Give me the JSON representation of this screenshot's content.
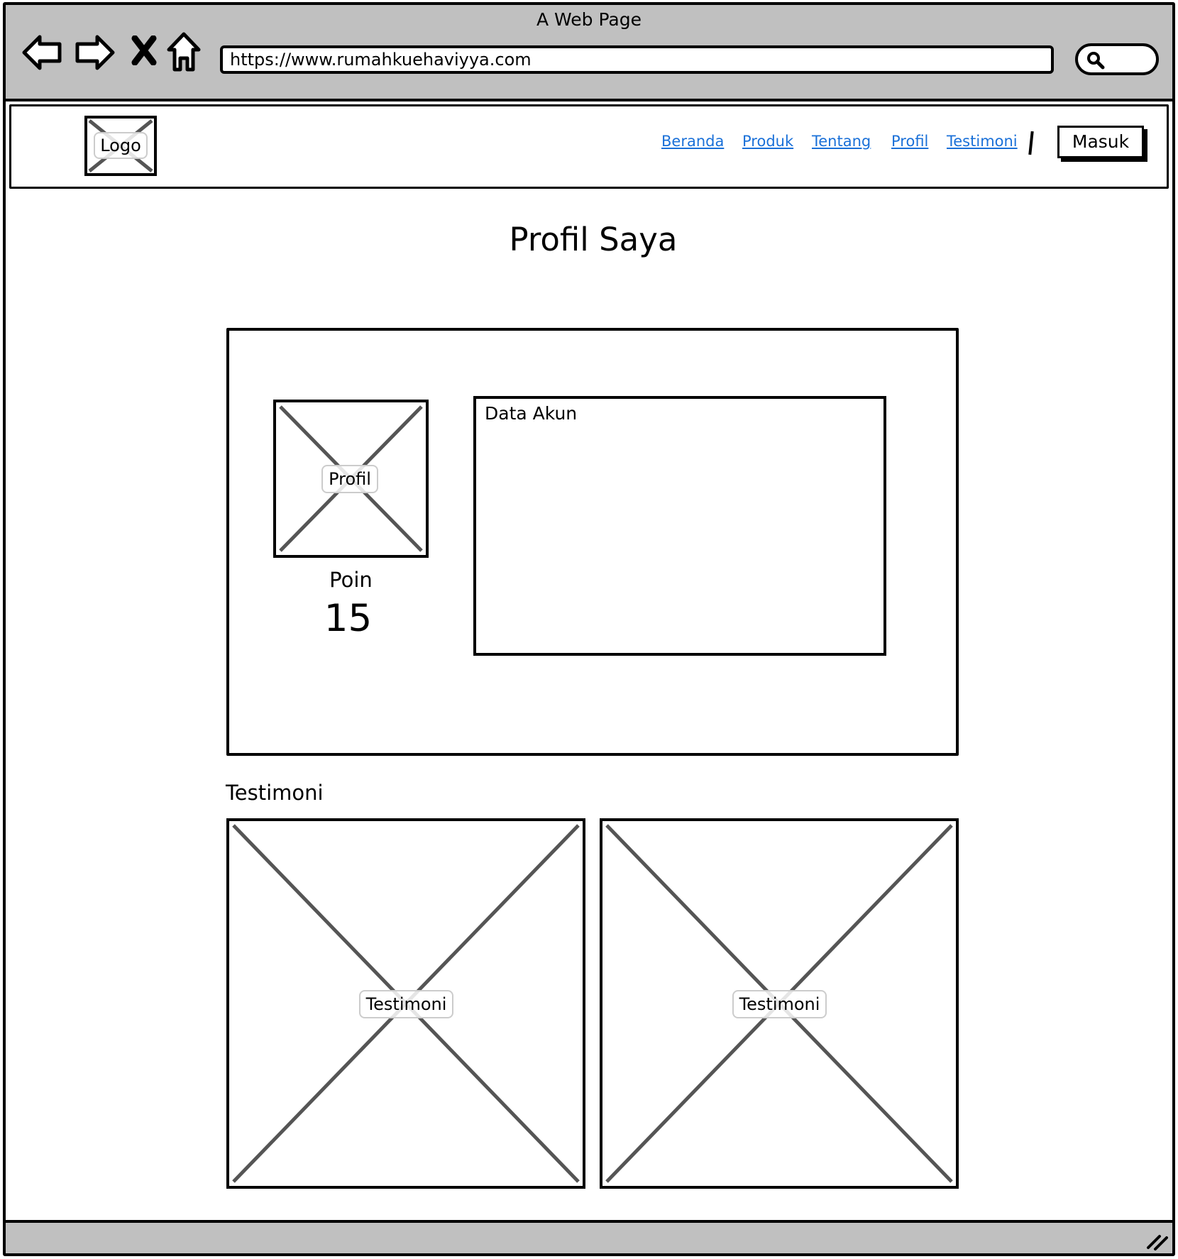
{
  "window": {
    "title": "A Web Page",
    "url": "https://www.rumahkuehaviyya.com"
  },
  "nav": {
    "logo_label": "Logo",
    "links": [
      "Beranda",
      "Produk",
      "Tentang",
      "Profil",
      "Testimoni"
    ],
    "login_label": "Masuk"
  },
  "page": {
    "title": "Profil Saya",
    "profile_image_label": "Profil",
    "points_label": "Poin",
    "points_value": "15",
    "account_data_label": "Data Akun",
    "testimonials_heading": "Testimoni",
    "testimonials": [
      {
        "image_label": "Testimoni"
      },
      {
        "image_label": "Testimoni"
      }
    ]
  }
}
